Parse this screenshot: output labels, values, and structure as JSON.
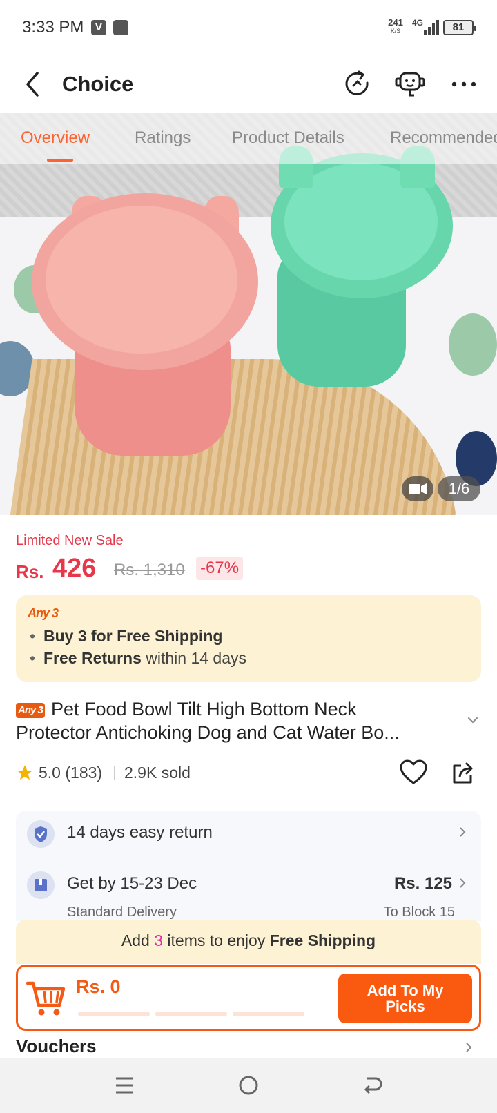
{
  "status_bar": {
    "time": "3:33 PM",
    "app_badge": "V",
    "net_speed": "241",
    "net_speed_unit": "K/S",
    "network": "4G",
    "battery": "81"
  },
  "header": {
    "title": "Choice",
    "icons": [
      "back-icon",
      "refresh-icon",
      "customer-service-icon",
      "more-icon"
    ]
  },
  "gallery": {
    "tabs": [
      {
        "label": "Overview",
        "active": true
      },
      {
        "label": "Ratings",
        "active": false
      },
      {
        "label": "Product Details",
        "active": false
      },
      {
        "label": "Recommended",
        "active": false
      }
    ],
    "image_counter": "1/6"
  },
  "price": {
    "sale_label": "Limited New Sale",
    "currency": "Rs.",
    "value": "426",
    "original": "Rs. 1,310",
    "discount": "-67%"
  },
  "promo": {
    "tag": "Any 3",
    "line1_bold": "Buy 3 for  Free Shipping",
    "line2_bold": "Free Returns",
    "line2_rest": " within 14 days"
  },
  "product": {
    "badge": "Any 3",
    "title_line1": "Pet Food Bowl Tilt High Bottom Neck",
    "title_line2": "Protector Antichoking Dog and Cat Water Bo...",
    "rating": "5.0",
    "reviews": "(183)",
    "sold": "2.9K sold"
  },
  "services": {
    "return_text": "14 days easy return",
    "delivery_text": "Get by 15-23 Dec",
    "delivery_sub": "Standard Delivery",
    "shipping_fee": "Rs. 125",
    "ship_to": "To Block 15"
  },
  "cart": {
    "ship_prefix": "Add ",
    "ship_count": "3",
    "ship_middle": " items to enjoy ",
    "ship_bold": "Free Shipping",
    "total": "Rs. 0",
    "button_line1": "Add To My",
    "button_line2": "Picks"
  },
  "vouchers": {
    "label": "Vouchers"
  },
  "colors": {
    "accent": "#fa6432",
    "price_red": "#e8374a",
    "promo_bg": "#fdf2d3",
    "button_orange": "#fa5a10"
  }
}
